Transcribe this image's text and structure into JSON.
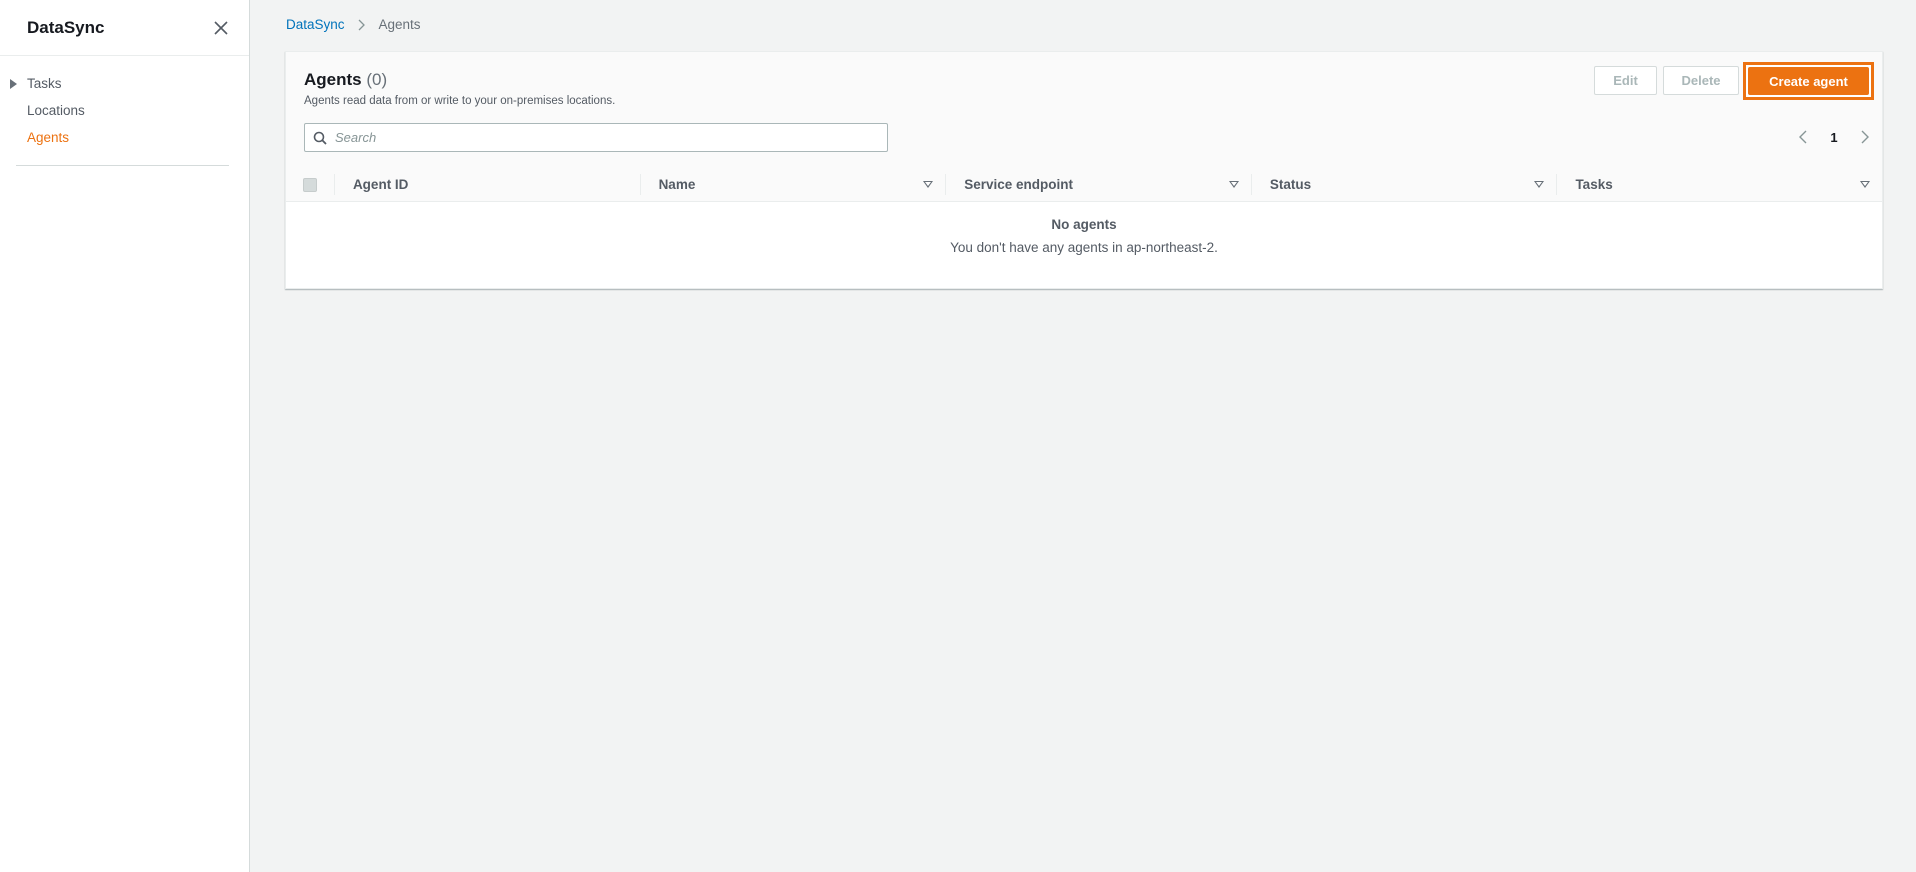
{
  "sidebar": {
    "title": "DataSync",
    "items": [
      {
        "label": "Tasks",
        "expandable": true,
        "active": false
      },
      {
        "label": "Locations",
        "expandable": false,
        "active": false
      },
      {
        "label": "Agents",
        "expandable": false,
        "active": true
      }
    ]
  },
  "breadcrumb": {
    "root": "DataSync",
    "current": "Agents"
  },
  "panel": {
    "title": "Agents",
    "count": "(0)",
    "description": "Agents read data from or write to your on-premises locations.",
    "buttons": {
      "edit": "Edit",
      "delete": "Delete",
      "create": "Create agent"
    },
    "search": {
      "placeholder": "Search",
      "value": ""
    },
    "pagination": {
      "current_page": "1"
    },
    "columns": [
      "Agent ID",
      "Name",
      "Service endpoint",
      "Status",
      "Tasks"
    ],
    "empty": {
      "title": "No agents",
      "message": "You don't have any agents in ap-northeast-2."
    }
  },
  "colors": {
    "accent": "#ec7211",
    "link": "#0073bb",
    "background": "#f2f3f3"
  },
  "icons": [
    "close-icon",
    "caret-right-icon",
    "chevron-right-icon",
    "search-icon",
    "chevron-left-icon",
    "sort-down-icon"
  ]
}
